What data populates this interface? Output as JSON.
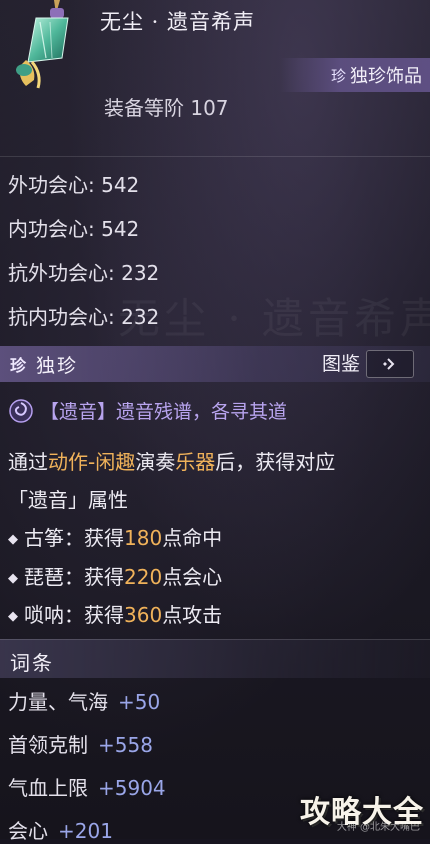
{
  "header": {
    "title": "无尘 · 遗音希声",
    "rarity_gem": "珍",
    "rarity_text": "独珍饰品",
    "equip_level": "装备等阶 107"
  },
  "stats": [
    "外功会心: 542",
    "内功会心: 542",
    "抗外功会心: 232",
    "抗内功会心: 232"
  ],
  "section": {
    "gem": "珍",
    "title": "独珍",
    "atlas_label": "图鉴"
  },
  "effect": {
    "tag": "【遗音】遗音残谱，各寻其道",
    "line1_a": "通过",
    "line1_hl": "动作-闲趣",
    "line1_b": "演奏",
    "line1_hl2": "乐器",
    "line1_c": "后，获得对应",
    "line2": "「遗音」属性",
    "bullets": [
      {
        "pre": "古筝：获得",
        "num": "180",
        "post": "点命中"
      },
      {
        "pre": "琵琶：获得",
        "num": "220",
        "post": "点会心"
      },
      {
        "pre": "唢呐：获得",
        "num": "360",
        "post": "点攻击"
      }
    ]
  },
  "affix": {
    "title": "词条",
    "rows": [
      {
        "name": "力量、气海",
        "value": "+50"
      },
      {
        "name": "首领克制",
        "value": "+558"
      },
      {
        "name": "气血上限",
        "value": "+5904"
      },
      {
        "name": "会心",
        "value": "+201"
      }
    ]
  },
  "logo": {
    "text": "攻略大全",
    "sub": "大神 @北朱大嘴巴"
  }
}
